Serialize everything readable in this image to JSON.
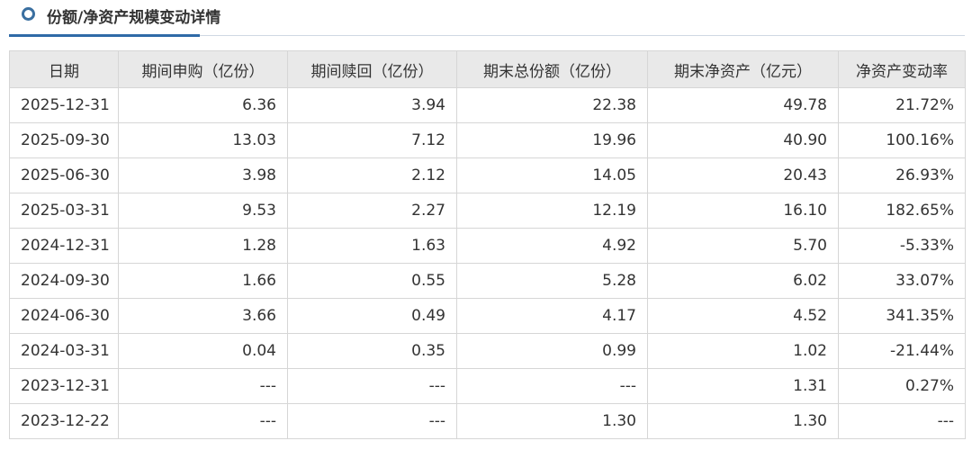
{
  "section": {
    "title": "份额/净资产规模变动详情"
  },
  "table": {
    "columns": [
      "日期",
      "期间申购（亿份）",
      "期间赎回（亿份）",
      "期末总份额（亿份）",
      "期末净资产（亿元）",
      "净资产变动率"
    ],
    "rows": [
      {
        "date": "2025-12-31",
        "subscribe": "6.36",
        "redeem": "3.94",
        "total_shares": "22.38",
        "net_assets": "49.78",
        "change_rate": "21.72%"
      },
      {
        "date": "2025-09-30",
        "subscribe": "13.03",
        "redeem": "7.12",
        "total_shares": "19.96",
        "net_assets": "40.90",
        "change_rate": "100.16%"
      },
      {
        "date": "2025-06-30",
        "subscribe": "3.98",
        "redeem": "2.12",
        "total_shares": "14.05",
        "net_assets": "20.43",
        "change_rate": "26.93%"
      },
      {
        "date": "2025-03-31",
        "subscribe": "9.53",
        "redeem": "2.27",
        "total_shares": "12.19",
        "net_assets": "16.10",
        "change_rate": "182.65%"
      },
      {
        "date": "2024-12-31",
        "subscribe": "1.28",
        "redeem": "1.63",
        "total_shares": "4.92",
        "net_assets": "5.70",
        "change_rate": "-5.33%"
      },
      {
        "date": "2024-09-30",
        "subscribe": "1.66",
        "redeem": "0.55",
        "total_shares": "5.28",
        "net_assets": "6.02",
        "change_rate": "33.07%"
      },
      {
        "date": "2024-06-30",
        "subscribe": "3.66",
        "redeem": "0.49",
        "total_shares": "4.17",
        "net_assets": "4.52",
        "change_rate": "341.35%"
      },
      {
        "date": "2024-03-31",
        "subscribe": "0.04",
        "redeem": "0.35",
        "total_shares": "0.99",
        "net_assets": "1.02",
        "change_rate": "-21.44%"
      },
      {
        "date": "2023-12-31",
        "subscribe": "---",
        "redeem": "---",
        "total_shares": "---",
        "net_assets": "1.31",
        "change_rate": "0.27%"
      },
      {
        "date": "2023-12-22",
        "subscribe": "---",
        "redeem": "---",
        "total_shares": "1.30",
        "net_assets": "1.30",
        "change_rate": "---"
      }
    ]
  },
  "icons": {
    "header": "circle-bullet-icon"
  },
  "colors": {
    "accent": "#2f6aa7",
    "header_bg": "#e9e9e9",
    "border": "#d6d6d6",
    "text": "#333333"
  }
}
